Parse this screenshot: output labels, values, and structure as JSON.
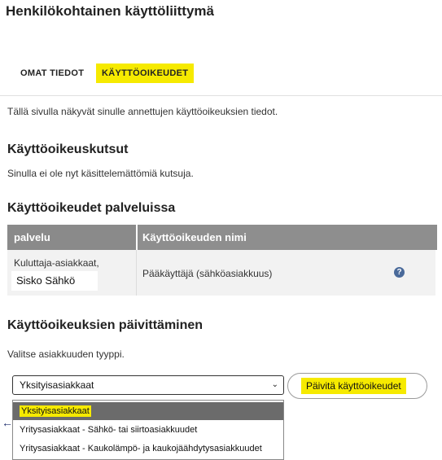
{
  "header": {
    "title": "Henkilökohtainen käyttöliittymä"
  },
  "tabs": [
    {
      "label": "OMAT TIEDOT"
    },
    {
      "label": "KÄYTTÖOIKEUDET"
    }
  ],
  "intro_text": "Tällä sivulla näkyvät sinulle annettujen käyttöoikeuksien tiedot.",
  "invitations": {
    "heading": "Käyttöoikeuskutsut",
    "text": "Sinulla ei ole nyt käsittelemättömiä kutsuja."
  },
  "services": {
    "heading": "Käyttöoikeudet palveluissa",
    "columns": [
      "palvelu",
      "Käyttöoikeuden nimi"
    ],
    "rows": [
      {
        "service": "Kuluttaja-asiakkaat,",
        "person": "Sisko Sähkö",
        "role": "Pääkäyttäjä (sähköasiakkuus)"
      }
    ]
  },
  "update": {
    "heading": "Käyttöoikeuksien päivittäminen",
    "instruction": "Valitse asiakkuuden tyyppi.",
    "selected": "Yksityisasiakkaat",
    "button_label": "Päivitä käyttöoikeudet",
    "options": [
      "Yksityisasiakkaat",
      "Yritysasiakkaat - Sähkö- tai siirtoasiakkuudet",
      "Yritysasiakkaat - Kaukolämpö- ja kaukojäähdytysasiakkuudet"
    ]
  },
  "colors": {
    "accent_yellow": "#f6ea00",
    "table_header": "#8a8a8a",
    "help_icon": "#4a6a9a"
  },
  "icons": {
    "help": "?",
    "chevron": "⌄",
    "back": "←"
  }
}
